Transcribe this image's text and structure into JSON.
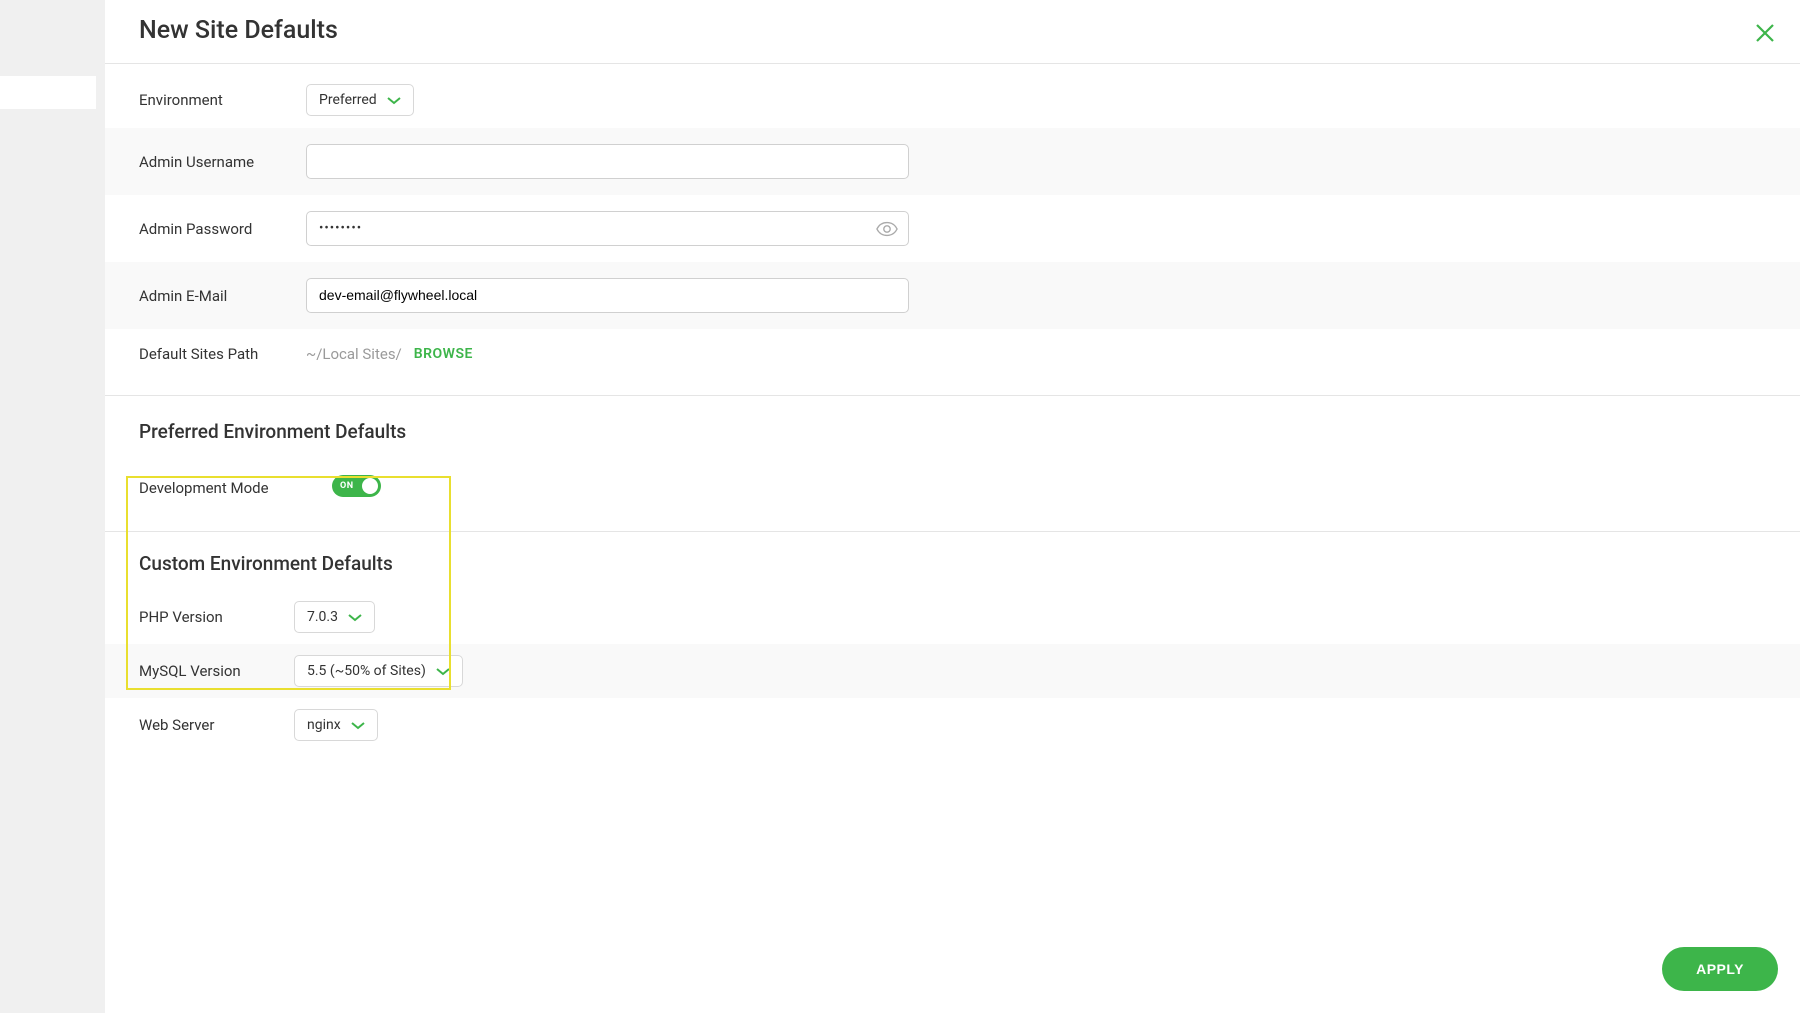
{
  "header": {
    "title": "New Site Defaults"
  },
  "section1": {
    "environment": {
      "label": "Environment",
      "value": "Preferred"
    },
    "admin_username": {
      "label": "Admin Username",
      "value": ""
    },
    "admin_password": {
      "label": "Admin Password",
      "value": "••••••••"
    },
    "admin_email": {
      "label": "Admin E-Mail",
      "value": "dev-email@flywheel.local"
    },
    "sites_path": {
      "label": "Default Sites Path",
      "value": "~/Local Sites/",
      "browse": "BROWSE"
    }
  },
  "section2": {
    "heading": "Preferred Environment Defaults",
    "dev_mode": {
      "label": "Development Mode",
      "state": "ON"
    }
  },
  "section3": {
    "heading": "Custom Environment Defaults",
    "php_version": {
      "label": "PHP Version",
      "value": "7.0.3"
    },
    "mysql_version": {
      "label": "MySQL Version",
      "value": "5.5 (~50% of Sites)"
    },
    "web_server": {
      "label": "Web Server",
      "value": "nginx"
    }
  },
  "footer": {
    "apply": "APPLY"
  }
}
